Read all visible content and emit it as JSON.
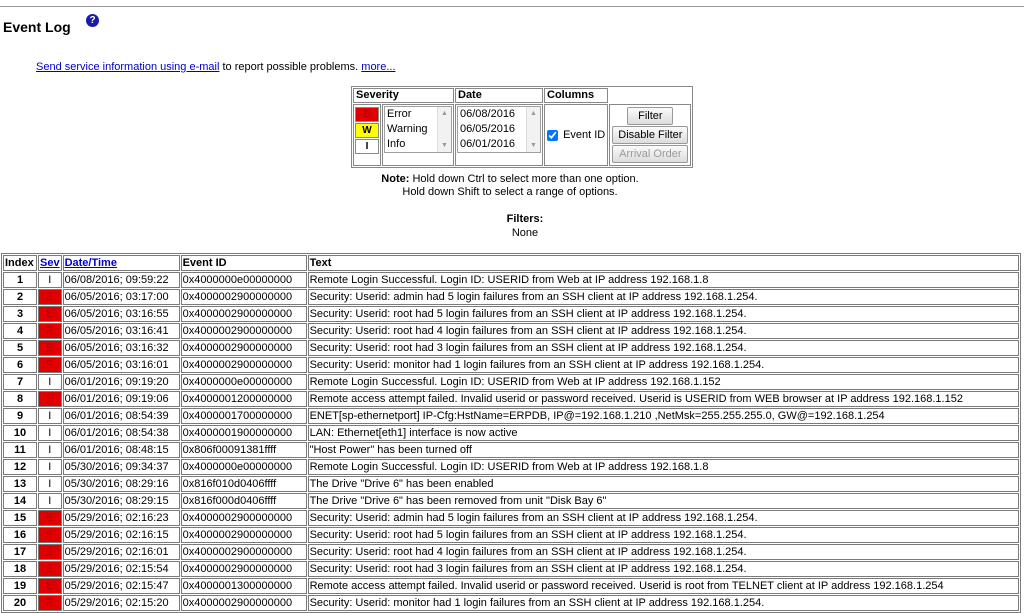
{
  "page": {
    "title": "Event Log"
  },
  "service": {
    "link": "Send service information using e-mail",
    "rest": " to report possible problems. ",
    "more": "more..."
  },
  "filter": {
    "headers": [
      "Severity",
      "Date",
      "Columns"
    ],
    "severities": [
      {
        "code": "E",
        "label": "Error",
        "color": "#e00000"
      },
      {
        "code": "W",
        "label": "Warning",
        "color": "#ffff00"
      },
      {
        "code": "I",
        "label": "Info",
        "color": "#ffffff"
      }
    ],
    "dates": [
      "06/08/2016",
      "06/05/2016",
      "06/01/2016"
    ],
    "column_option": "Event ID",
    "buttons": {
      "filter": "Filter",
      "disable": "Disable Filter",
      "arrival": "Arrival Order"
    }
  },
  "note": {
    "prefix": "Note:",
    "line1": " Hold down Ctrl to select more than one option.",
    "line2": "Hold down Shift to select a range of options."
  },
  "filters": {
    "label": "Filters:",
    "value": "None"
  },
  "log": {
    "headers": {
      "index": "Index",
      "sev": "Sev",
      "date": "Date/Time",
      "event_id": "Event ID",
      "text": "Text"
    },
    "rows": [
      {
        "index": "1",
        "sev": "I",
        "date": "06/08/2016; 09:59:22",
        "event_id": "0x4000000e00000000",
        "text": "Remote Login Successful. Login ID: USERID from Web at IP address 192.168.1.8"
      },
      {
        "index": "2",
        "sev": "E",
        "date": "06/05/2016; 03:17:00",
        "event_id": "0x4000002900000000",
        "text": "Security: Userid: admin had 5 login failures from an SSH client at IP address 192.168.1.254."
      },
      {
        "index": "3",
        "sev": "E",
        "date": "06/05/2016; 03:16:55",
        "event_id": "0x4000002900000000",
        "text": "Security: Userid: root had 5 login failures from an SSH client at IP address 192.168.1.254."
      },
      {
        "index": "4",
        "sev": "E",
        "date": "06/05/2016; 03:16:41",
        "event_id": "0x4000002900000000",
        "text": "Security: Userid: root had 4 login failures from an SSH client at IP address 192.168.1.254."
      },
      {
        "index": "5",
        "sev": "E",
        "date": "06/05/2016; 03:16:32",
        "event_id": "0x4000002900000000",
        "text": "Security: Userid: root had 3 login failures from an SSH client at IP address 192.168.1.254."
      },
      {
        "index": "6",
        "sev": "E",
        "date": "06/05/2016; 03:16:01",
        "event_id": "0x4000002900000000",
        "text": "Security: Userid: monitor had 1 login failures from an SSH client at IP address 192.168.1.254."
      },
      {
        "index": "7",
        "sev": "I",
        "date": "06/01/2016; 09:19:20",
        "event_id": "0x4000000e00000000",
        "text": "Remote Login Successful. Login ID: USERID from Web at IP address 192.168.1.152"
      },
      {
        "index": "8",
        "sev": "E",
        "date": "06/01/2016; 09:19:06",
        "event_id": "0x4000001200000000",
        "text": "Remote access attempt failed. Invalid userid or password received. Userid is USERID from WEB browser at IP address 192.168.1.152"
      },
      {
        "index": "9",
        "sev": "I",
        "date": "06/01/2016; 08:54:39",
        "event_id": "0x4000001700000000",
        "text": "ENET[sp-ethernetport] IP-Cfg:HstName=ERPDB, IP@=192.168.1.210 ,NetMsk=255.255.255.0, GW@=192.168.1.254"
      },
      {
        "index": "10",
        "sev": "I",
        "date": "06/01/2016; 08:54:38",
        "event_id": "0x4000001900000000",
        "text": "LAN: Ethernet[eth1] interface is now active"
      },
      {
        "index": "11",
        "sev": "I",
        "date": "06/01/2016; 08:48:15",
        "event_id": "0x806f00091381ffff",
        "text": "\"Host Power\" has been turned off"
      },
      {
        "index": "12",
        "sev": "I",
        "date": "05/30/2016; 09:34:37",
        "event_id": "0x4000000e00000000",
        "text": "Remote Login Successful. Login ID: USERID from Web at IP address 192.168.1.8"
      },
      {
        "index": "13",
        "sev": "I",
        "date": "05/30/2016; 08:29:16",
        "event_id": "0x816f010d0406ffff",
        "text": "The Drive \"Drive 6\" has been enabled"
      },
      {
        "index": "14",
        "sev": "I",
        "date": "05/30/2016; 08:29:15",
        "event_id": "0x816f000d0406ffff",
        "text": "The Drive \"Drive 6\" has been removed from unit \"Disk Bay 6\""
      },
      {
        "index": "15",
        "sev": "E",
        "date": "05/29/2016; 02:16:23",
        "event_id": "0x4000002900000000",
        "text": "Security: Userid: admin had 5 login failures from an SSH client at IP address 192.168.1.254."
      },
      {
        "index": "16",
        "sev": "E",
        "date": "05/29/2016; 02:16:15",
        "event_id": "0x4000002900000000",
        "text": "Security: Userid: root had 5 login failures from an SSH client at IP address 192.168.1.254."
      },
      {
        "index": "17",
        "sev": "E",
        "date": "05/29/2016; 02:16:01",
        "event_id": "0x4000002900000000",
        "text": "Security: Userid: root had 4 login failures from an SSH client at IP address 192.168.1.254."
      },
      {
        "index": "18",
        "sev": "E",
        "date": "05/29/2016; 02:15:54",
        "event_id": "0x4000002900000000",
        "text": "Security: Userid: root had 3 login failures from an SSH client at IP address 192.168.1.254."
      },
      {
        "index": "19",
        "sev": "E",
        "date": "05/29/2016; 02:15:47",
        "event_id": "0x4000001300000000",
        "text": "Remote access attempt failed. Invalid userid or password received. Userid is root from TELNET client at IP address 192.168.1.254"
      },
      {
        "index": "20",
        "sev": "E",
        "date": "05/29/2016; 02:15:20",
        "event_id": "0x4000002900000000",
        "text": "Security: Userid: monitor had 1 login failures from an SSH client at IP address 192.168.1.254."
      }
    ]
  }
}
